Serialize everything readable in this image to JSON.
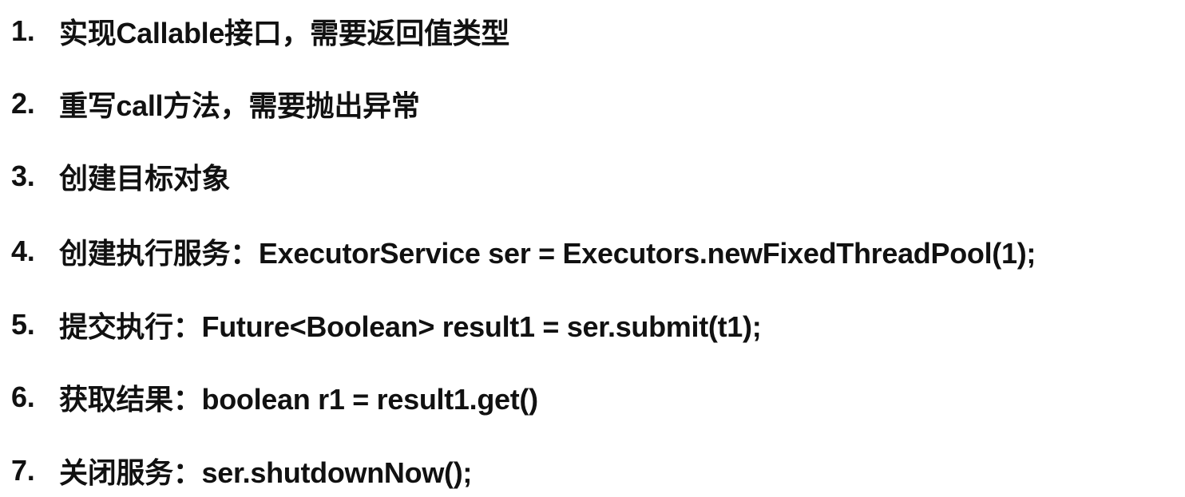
{
  "steps": [
    {
      "number": "1.",
      "text": "实现Callable接口，需要返回值类型"
    },
    {
      "number": "2.",
      "text": "重写call方法，需要抛出异常"
    },
    {
      "number": "3.",
      "text": "创建目标对象"
    },
    {
      "number": "4.",
      "text": "创建执行服务：ExecutorService ser = Executors.newFixedThreadPool(1);"
    },
    {
      "number": "5.",
      "text": "提交执行：Future<Boolean> result1 = ser.submit(t1);"
    },
    {
      "number": "6.",
      "text": "获取结果：boolean r1 = result1.get()"
    },
    {
      "number": "7.",
      "text": "关闭服务：ser.shutdownNow();"
    }
  ]
}
